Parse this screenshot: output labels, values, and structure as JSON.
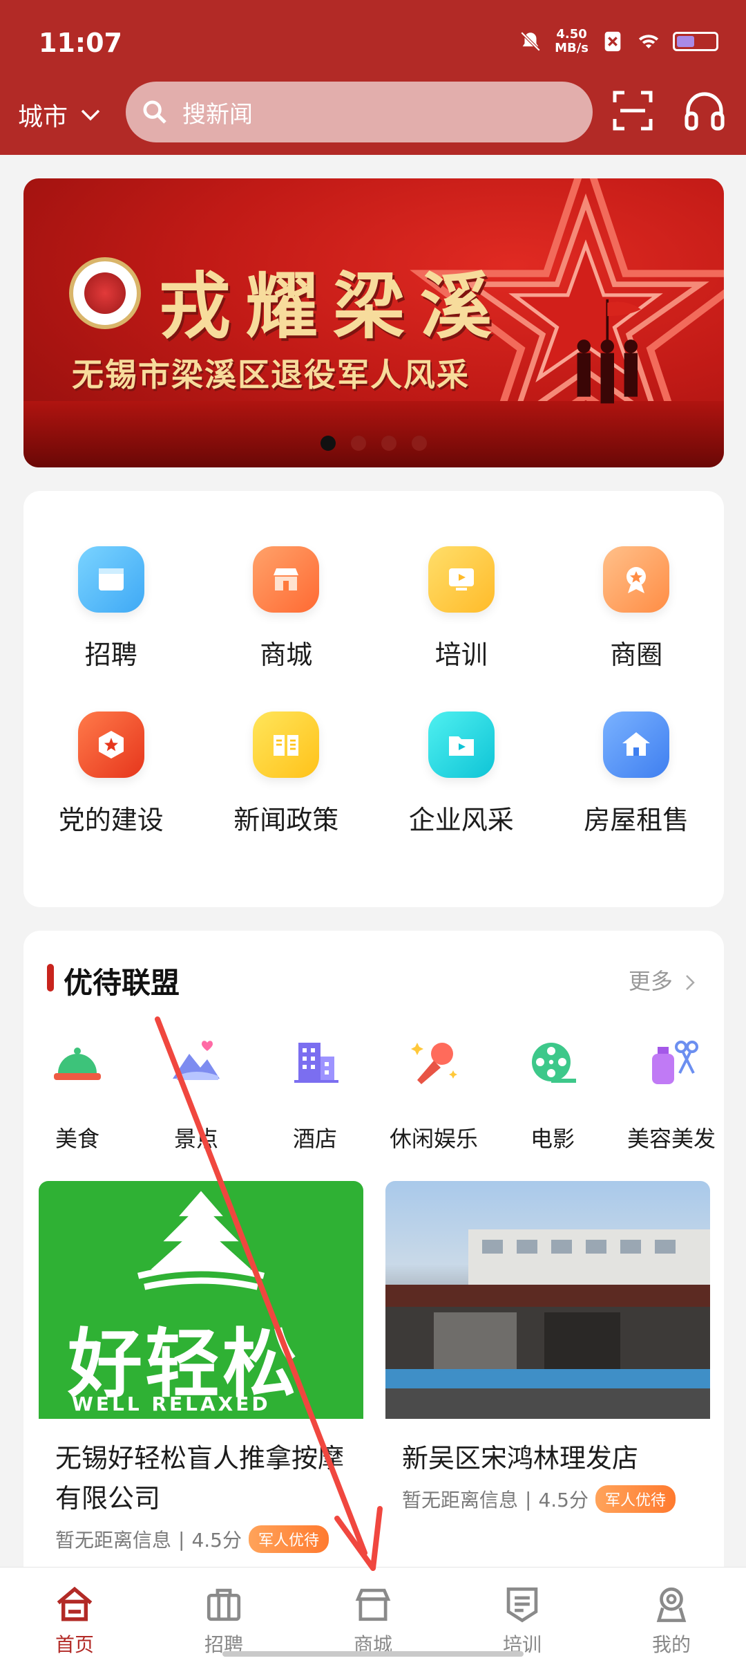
{
  "status": {
    "time": "11:07",
    "speed_value": "4.50",
    "speed_unit": "MB/s"
  },
  "header": {
    "city": "城市",
    "search_placeholder": "搜新闻"
  },
  "banner": {
    "title": "戎耀梁溪",
    "subtitle": "无锡市梁溪区退役军人风采",
    "slide_count": 4,
    "active_slide": 1
  },
  "grid": [
    {
      "label": "招聘",
      "icon": "browser-window-icon",
      "color": "#5bc0f8"
    },
    {
      "label": "商城",
      "icon": "storefront-icon",
      "color": "#ff8a4c"
    },
    {
      "label": "培训",
      "icon": "video-screen-icon",
      "color": "#ffc93c"
    },
    {
      "label": "商圈",
      "icon": "medal-icon",
      "color": "#ffa05a"
    },
    {
      "label": "党的建设",
      "icon": "party-star-icon",
      "color": "#f4562e"
    },
    {
      "label": "新闻政策",
      "icon": "newspaper-icon",
      "color": "#ffd233"
    },
    {
      "label": "企业风采",
      "icon": "folder-play-icon",
      "color": "#1ed7e3"
    },
    {
      "label": "房屋租售",
      "icon": "house-icon",
      "color": "#4f8ef5"
    }
  ],
  "alliance": {
    "title": "优待联盟",
    "more": "更多",
    "categories": [
      {
        "label": "美食",
        "icon": "food-cloche-icon"
      },
      {
        "label": "景点",
        "icon": "mountain-heart-icon"
      },
      {
        "label": "酒店",
        "icon": "hotel-building-icon"
      },
      {
        "label": "休闲娱乐",
        "icon": "microphone-icon"
      },
      {
        "label": "电影",
        "icon": "film-reel-icon"
      },
      {
        "label": "美容美发",
        "icon": "scissors-bottle-icon"
      }
    ],
    "stores": [
      {
        "name": "无锡好轻松盲人推拿按摩有限公司",
        "distance": "暂无距离信息",
        "rating": "4.5分",
        "badge": "军人优待",
        "logo_text": "好轻松",
        "logo_sub": "WELL RELAXED"
      },
      {
        "name": "新吴区宋鸿林理发店",
        "distance": "暂无距离信息",
        "rating": "4.5分",
        "badge": "军人优待"
      }
    ]
  },
  "tabs": [
    {
      "label": "首页",
      "icon": "home-icon",
      "active": true
    },
    {
      "label": "招聘",
      "icon": "briefcase-icon",
      "active": false
    },
    {
      "label": "商城",
      "icon": "shop-icon",
      "active": false
    },
    {
      "label": "培训",
      "icon": "training-shield-icon",
      "active": false
    },
    {
      "label": "我的",
      "icon": "profile-icon",
      "active": false
    }
  ],
  "colors": {
    "brand_red": "#b22a26",
    "badge_orange": "#ff8a3d",
    "banner_gold": "#f7dc9c",
    "annotation_arrow": "#f0473f"
  }
}
